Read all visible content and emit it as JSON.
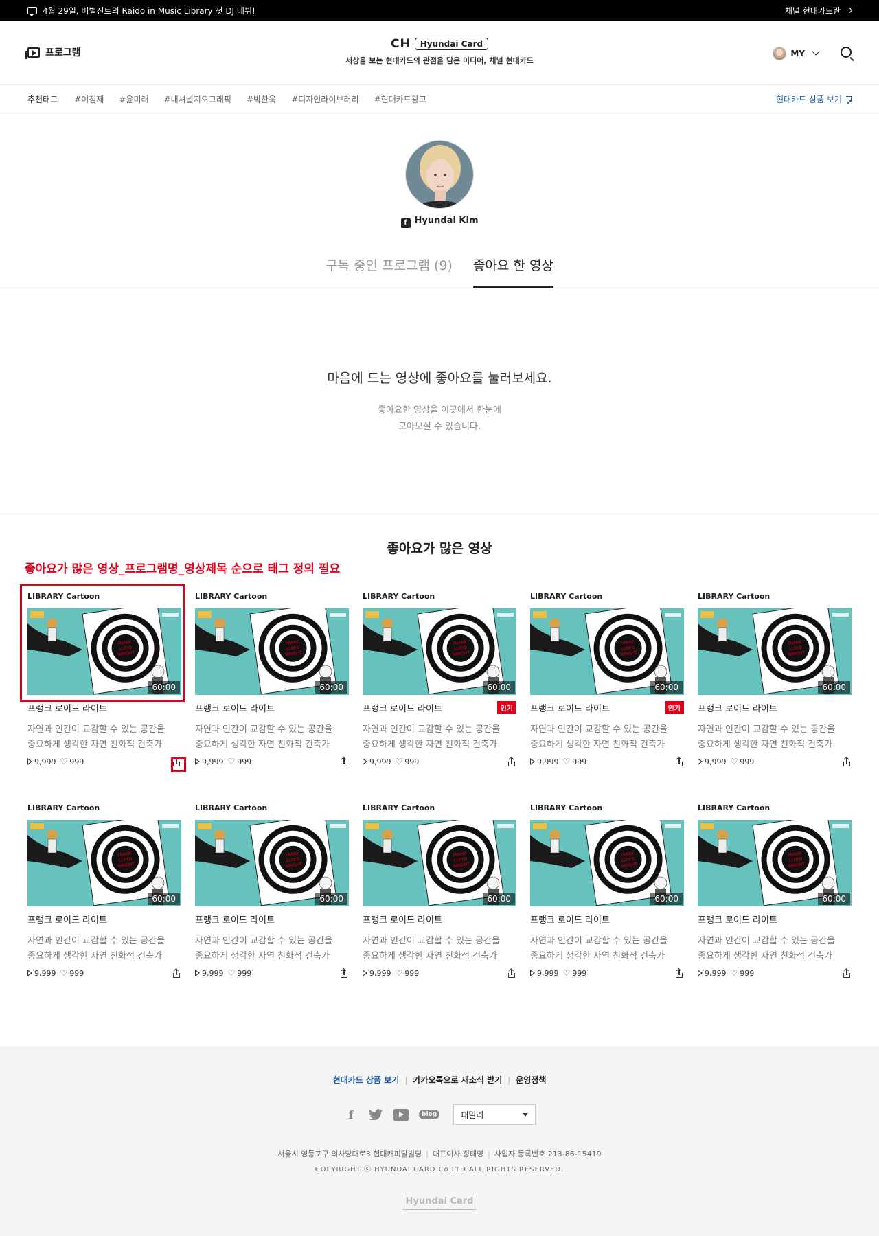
{
  "notice": {
    "text": "4월 29일, 버벌진트의 Raido in Music Library 첫 DJ 데뷔!",
    "right_link": "채널 현대카드란"
  },
  "header": {
    "program_label": "프로그램",
    "logo_ch": "CH",
    "logo_brand": "Hyundai Card",
    "tagline": "세상을 보는 현대카드의 관점을 담은 미디어, 채널 현대카드",
    "my_label": "MY"
  },
  "tags": {
    "label": "추천태그",
    "items": [
      "#이정재",
      "#윤미래",
      "#내셔널지오그래픽",
      "#박찬욱",
      "#디자인라이브러리",
      "#현대카드광고"
    ],
    "product_link": "현대카드 상품 보기"
  },
  "profile": {
    "name": "Hyundai Kim",
    "fb_icon": "f"
  },
  "tabs": [
    {
      "label": "구독 중인 프로그램 (9)"
    },
    {
      "label": "좋아요 한 영상"
    }
  ],
  "empty": {
    "title": "마음에 드는 영상에 좋아요를 눌러보세요.",
    "desc_line1": "좋아요한 영상을 이곳에서 한눈에",
    "desc_line2": "모아보실 수 있습니다."
  },
  "section": {
    "title": "좋아요가 많은 영상",
    "annotation": "좋아요가 많은 영상_프로그램명_영상제목 순으로 태그 정의 필요"
  },
  "cards": [
    {
      "category": "LIBRARY Cartoon",
      "duration": "60:00",
      "title": "프랭크 로이드 라이트",
      "hot": "",
      "desc1": "자연과 인간이 교감할 수 있는 공간을",
      "desc2": "중요하게 생각한 자연 친화적 건축가",
      "views": "9,999",
      "likes": "999"
    },
    {
      "category": "LIBRARY Cartoon",
      "duration": "60:00",
      "title": "프랭크 로이드 라이트",
      "hot": "",
      "desc1": "자연과 인간이 교감할 수 있는 공간을",
      "desc2": "중요하게 생각한 자연 친화적 건축가",
      "views": "9,999",
      "likes": "999"
    },
    {
      "category": "LIBRARY Cartoon",
      "duration": "60:00",
      "title": "프랭크 로이드 라이트",
      "hot": "인기",
      "desc1": "자연과 인간이 교감할 수 있는 공간을",
      "desc2": "중요하게 생각한 자연 친화적 건축가",
      "views": "9,999",
      "likes": "999"
    },
    {
      "category": "LIBRARY Cartoon",
      "duration": "60:00",
      "title": "프랭크 로이드 라이트",
      "hot": "인기",
      "desc1": "자연과 인간이 교감할 수 있는 공간을",
      "desc2": "중요하게 생각한 자연 친화적 건축가",
      "views": "9,999",
      "likes": "999"
    },
    {
      "category": "LIBRARY Cartoon",
      "duration": "60:00",
      "title": "프랭크 로이드 라이트",
      "hot": "",
      "desc1": "자연과 인간이 교감할 수 있는 공간을",
      "desc2": "중요하게 생각한 자연 친화적 건축가",
      "views": "9,999",
      "likes": "999"
    },
    {
      "category": "LIBRARY Cartoon",
      "duration": "60:00",
      "title": "프랭크 로이드 라이트",
      "hot": "",
      "desc1": "자연과 인간이 교감할 수 있는 공간을",
      "desc2": "중요하게 생각한 자연 친화적 건축가",
      "views": "9,999",
      "likes": "999"
    },
    {
      "category": "LIBRARY Cartoon",
      "duration": "60:00",
      "title": "프랭크 로이드 라이트",
      "hot": "",
      "desc1": "자연과 인간이 교감할 수 있는 공간을",
      "desc2": "중요하게 생각한 자연 친화적 건축가",
      "views": "9,999",
      "likes": "999"
    },
    {
      "category": "LIBRARY Cartoon",
      "duration": "60:00",
      "title": "프랭크 로이드 라이트",
      "hot": "",
      "desc1": "자연과 인간이 교감할 수 있는 공간을",
      "desc2": "중요하게 생각한 자연 친화적 건축가",
      "views": "9,999",
      "likes": "999"
    },
    {
      "category": "LIBRARY Cartoon",
      "duration": "60:00",
      "title": "프랭크 로이드 라이트",
      "hot": "",
      "desc1": "자연과 인간이 교감할 수 있는 공간을",
      "desc2": "중요하게 생각한 자연 친화적 건축가",
      "views": "9,999",
      "likes": "999"
    },
    {
      "category": "LIBRARY Cartoon",
      "duration": "60:00",
      "title": "프랭크 로이드 라이트",
      "hot": "",
      "desc1": "자연과 인간이 교감할 수 있는 공간을",
      "desc2": "중요하게 생각한 자연 친화적 건축가",
      "views": "9,999",
      "likes": "999"
    }
  ],
  "footer": {
    "link_product": "현대카드 상품 보기",
    "link_kakao": "카카오톡으로 새소식 받기",
    "link_policy": "운영정책",
    "social": {
      "facebook": "f",
      "blog": "blog"
    },
    "family_select": "패밀리",
    "address": "서울시 영등포구 의사당대로3 현대캐피탈빌딩",
    "ceo": "대표이사  정태영",
    "biz_no": "사업자 등록번호  213-86-15419",
    "copyright": "COPYRIGHT ⓒ HYUNDAI CARD Co.LTD ALL RIGHTS RESERVED.",
    "logo": "Hyundai Card"
  },
  "colors": {
    "accent_red": "#e0001b",
    "link_blue": "#1f5fae",
    "thumb_teal": "#67c1bd"
  },
  "icons": [
    "chat-icon",
    "program-icon",
    "chevron-down-icon",
    "search-icon",
    "arrow-up-right-icon",
    "facebook-icon",
    "play-icon",
    "heart-icon",
    "share-icon",
    "twitter-icon",
    "youtube-icon",
    "blog-icon"
  ]
}
